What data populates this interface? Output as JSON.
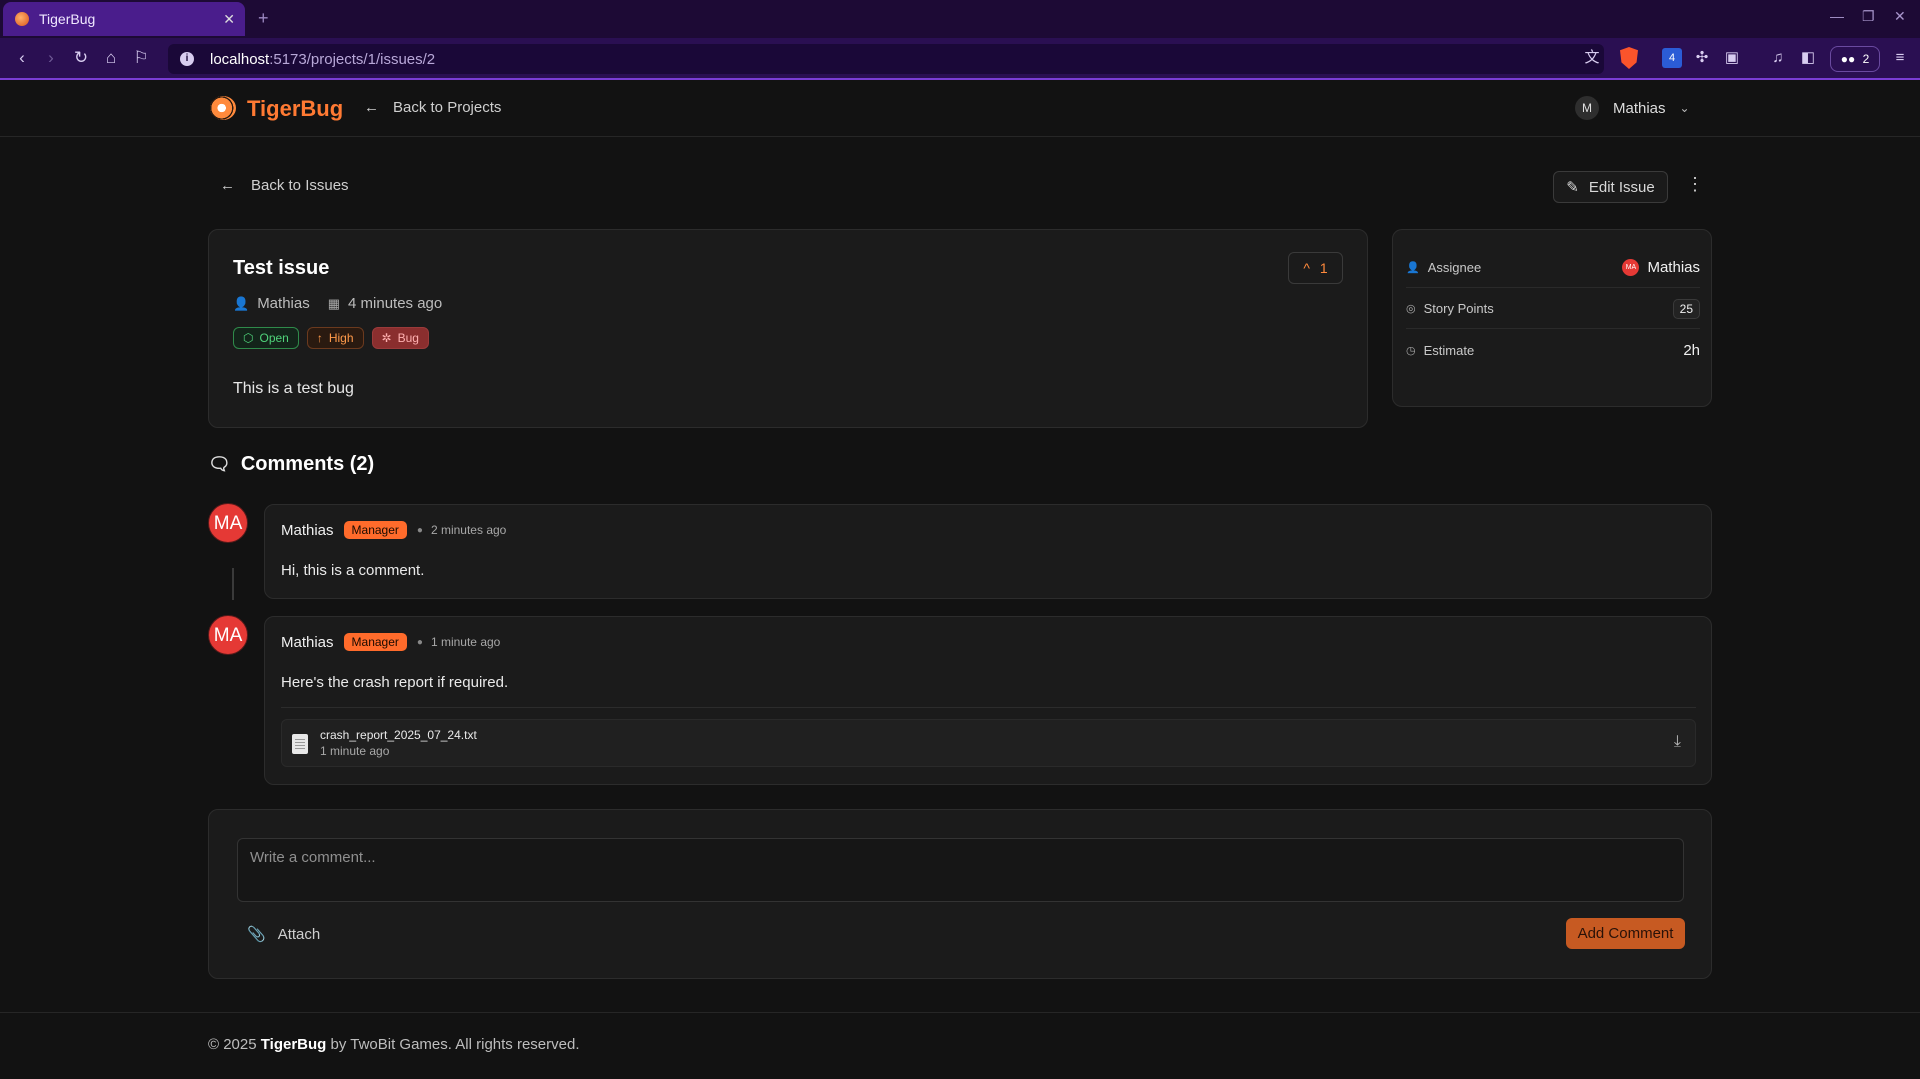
{
  "browser": {
    "tab_title": "TigerBug",
    "url_host": "localhost",
    "url_path": ":5173/projects/1/issues/2",
    "wallet_count": "2",
    "ext_badge": "4"
  },
  "header": {
    "brand": "TigerBug",
    "back_projects": "Back to Projects",
    "user_initial": "M",
    "user_name": "Mathias"
  },
  "toolbar": {
    "back_issues": "Back to Issues",
    "edit_label": "Edit Issue"
  },
  "issue": {
    "title": "Test issue",
    "author": "Mathias",
    "created": "4 minutes ago",
    "upvotes": "1",
    "badges": {
      "status": "Open",
      "priority": "High",
      "type": "Bug"
    },
    "description": "This is a test bug"
  },
  "details": {
    "assignee_label": "Assignee",
    "assignee_initials": "MA",
    "assignee_name": "Mathias",
    "points_label": "Story Points",
    "points_value": "25",
    "estimate_label": "Estimate",
    "estimate_value": "2h"
  },
  "comments": {
    "heading": "Comments (2)",
    "items": [
      {
        "initials": "MA",
        "author": "Mathias",
        "role": "Manager",
        "time": "2 minutes ago",
        "body": "Hi, this is a comment."
      },
      {
        "initials": "MA",
        "author": "Mathias",
        "role": "Manager",
        "time": "1 minute ago",
        "body": "Here's the crash report if required.",
        "attachment": {
          "name": "crash_report_2025_07_24.txt",
          "time": "1 minute ago"
        }
      }
    ]
  },
  "composer": {
    "placeholder": "Write a comment...",
    "attach_label": "Attach",
    "submit_label": "Add Comment"
  },
  "footer": {
    "prefix": "© 2025",
    "brand": "TigerBug",
    "suffix": "by TwoBit Games. All rights reserved."
  },
  "colors": {
    "accent": "#ff7a33",
    "background": "#121212",
    "card": "#1b1b1b",
    "avatar": "#e53935",
    "status_open": "#4fd37a",
    "priority_high": "#ff9a4a",
    "browser_chrome": "#2a0f52"
  }
}
